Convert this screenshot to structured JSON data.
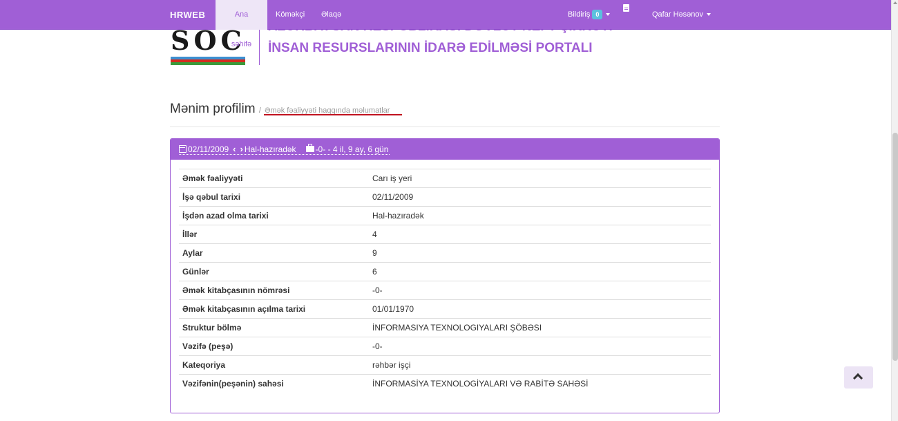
{
  "navbar": {
    "brand": "HRWEB",
    "items": [
      {
        "label": "Ana səhifə"
      },
      {
        "label": "Köməkçi"
      },
      {
        "label": "Əlaqə"
      }
    ],
    "notifications_label": "Bildiriş",
    "notifications_count": "0",
    "user_name": "Qafar Həsənov"
  },
  "banner": {
    "logo_text": "SOCAR",
    "line1": "AZƏRBAYCAN RESPUBLİKASI DÖVLƏT NEFT ŞİRKƏTİ",
    "line2": "İNSAN RESURSLARININ İDARƏ EDİLMƏSİ PORTALI"
  },
  "page": {
    "title": "Mənim profilim",
    "separator": "/",
    "subtitle": "Əmək fəaliyyəti haqqında məlumatlar"
  },
  "panel": {
    "start_date": "02/11/2009",
    "end_date": "Hal-hazıradək",
    "duration": "-0- - 4 il, 9 ay, 6 gün"
  },
  "details": [
    {
      "label": "Əmək fəaliyyəti",
      "value": "Carı iş yeri"
    },
    {
      "label": "İşə qəbul tarixi",
      "value": "02/11/2009"
    },
    {
      "label": "İşdən azad olma tarixi",
      "value": "Hal-hazıradək"
    },
    {
      "label": "İllər",
      "value": "4"
    },
    {
      "label": "Aylar",
      "value": "9"
    },
    {
      "label": "Günlər",
      "value": "6"
    },
    {
      "label": "Əmək kitabçasının nömrəsi",
      "value": "-0-"
    },
    {
      "label": "Əmək kitabçasının açılma tarixi",
      "value": "01/01/1970"
    },
    {
      "label": "Struktur bölmə",
      "value": "İNFORMASIYA TEXNOLOGIYALARI ŞÖBƏSI"
    },
    {
      "label": "Vəzifə (peşə)",
      "value": "-0-"
    },
    {
      "label": "Kateqoriya",
      "value": "rəhbər işçi"
    },
    {
      "label": "Vəzifənin(peşənin) sahəsi",
      "value": "İNFORMASİYA TEXNOLOGİYALARI VƏ RABİTƏ SAHƏSİ"
    }
  ],
  "colors": {
    "accent": "#a05fd6",
    "badge": "#5bc0de",
    "underline": "#c1121f"
  }
}
